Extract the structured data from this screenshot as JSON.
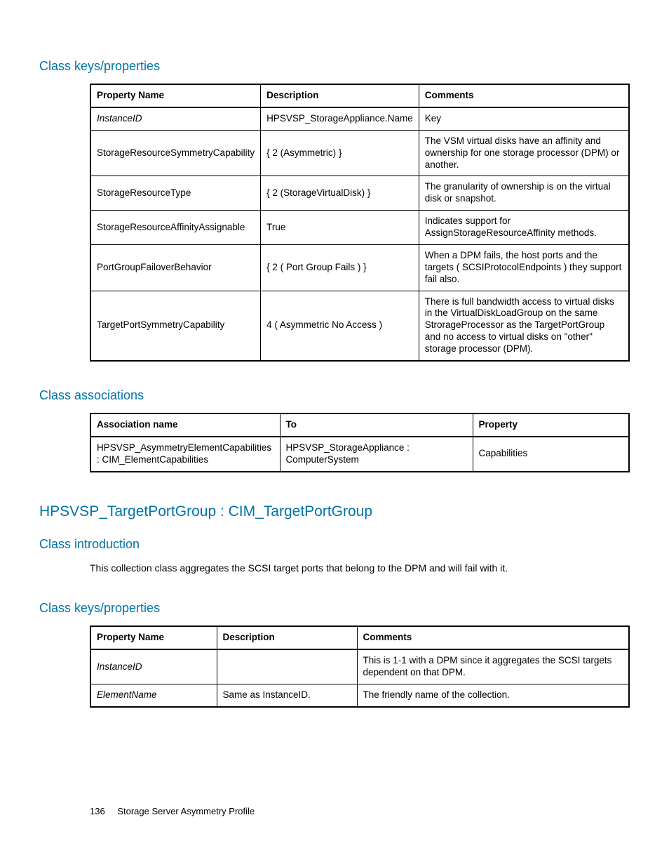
{
  "sections": {
    "props1": {
      "heading": "Class keys/properties",
      "headers": [
        "Property Name",
        "Description",
        "Comments"
      ],
      "rows": [
        {
          "name": "InstanceID",
          "italic": true,
          "desc": "HPSVSP_StorageAppliance.Name",
          "comment": "Key"
        },
        {
          "name": "StorageResourceSymmetryCapability",
          "italic": false,
          "desc": "{ 2 (Asymmetric) }",
          "comment": "The VSM virtual disks have an affinity and ownership for one storage processor (DPM) or another."
        },
        {
          "name": "StorageResourceType",
          "italic": false,
          "desc": "{ 2 (StorageVirtualDisk) }",
          "comment": "The granularity of ownership is on the virtual disk or snapshot."
        },
        {
          "name": "StorageResourceAffinityAssignable",
          "italic": false,
          "desc": "True",
          "comment": "Indicates support for AssignStorageResourceAffinity methods."
        },
        {
          "name": "PortGroupFailoverBehavior",
          "italic": false,
          "desc": "{ 2 ( Port Group Fails ) }",
          "comment": "When a DPM fails, the host ports and the targets ( SCSIProtocolEndpoints ) they support fail also."
        },
        {
          "name": "TargetPortSymmetryCapability",
          "italic": false,
          "desc": "4 ( Asymmetric No Access )",
          "comment": "There is full bandwidth access to virtual disks in the VirtualDiskLoadGroup on the same StrorageProcessor as the TargetPortGroup and no access to virtual disks on \"other\" storage processor (DPM)."
        }
      ]
    },
    "assoc": {
      "heading": "Class associations",
      "headers": [
        "Association name",
        "To",
        "Property"
      ],
      "rows": [
        {
          "name": "HPSVSP_AsymmetryElementCapabilities : CIM_ElementCapabilities",
          "to": "HPSVSP_StorageAppliance : ComputerSystem",
          "prop": "Capabilities"
        }
      ]
    },
    "class2": {
      "heading": "HPSVSP_TargetPortGroup : CIM_TargetPortGroup"
    },
    "intro": {
      "heading": "Class introduction",
      "text": "This collection class aggregates the SCSI target ports that belong to the DPM and will fail with it."
    },
    "props2": {
      "heading": "Class keys/properties",
      "headers": [
        "Property Name",
        "Description",
        "Comments"
      ],
      "rows": [
        {
          "name": "InstanceID",
          "italic": true,
          "desc": "",
          "comment": "This is 1-1 with a DPM since it aggregates the SCSI targets dependent on that DPM."
        },
        {
          "name": "ElementName",
          "italic": true,
          "desc": "Same as InstanceID.",
          "comment": "The friendly name of the collection."
        }
      ]
    }
  },
  "footer": {
    "page": "136",
    "title": "Storage Server Asymmetry Profile"
  }
}
